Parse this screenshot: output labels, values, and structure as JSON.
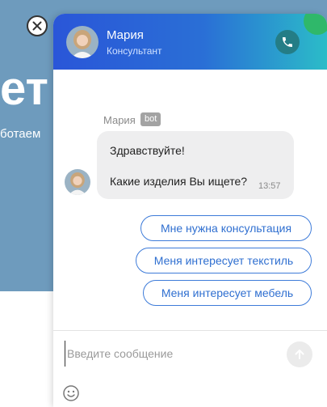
{
  "background": {
    "hero_text": "ет",
    "sub_text": "ботаем"
  },
  "chat": {
    "header": {
      "agent_name": "Мария",
      "agent_role": "Консультант"
    },
    "message": {
      "sender": "Мария",
      "badge": "bot",
      "line1": "Здравствуйте!",
      "line2": "Какие изделия Вы ищете?",
      "time": "13:57"
    },
    "quick_replies": [
      {
        "label": "Мне нужна консультация"
      },
      {
        "label": "Меня интересует текстиль"
      },
      {
        "label": "Меня интересует мебель"
      }
    ],
    "input": {
      "placeholder": "Введите сообщение",
      "value": ""
    }
  },
  "colors": {
    "header_start": "#2a56d8",
    "header_end": "#2bbcc8",
    "accent": "#3d7bd9",
    "call_button": "#247d86"
  },
  "icons": {
    "close": "close-icon",
    "call": "phone-icon",
    "send": "arrow-up-icon",
    "emoji": "smile-icon"
  }
}
